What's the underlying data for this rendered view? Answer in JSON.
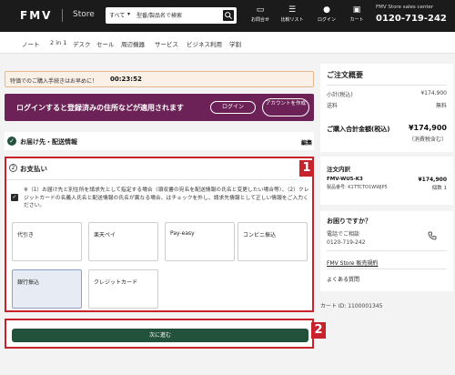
{
  "header": {
    "logo": "FMV",
    "store": "Store",
    "search_category": "すべて",
    "search_placeholder": "型番/製品名で検索",
    "buttons": [
      {
        "label": "お問合せ",
        "icon": "chat-icon"
      },
      {
        "label": "比較リスト",
        "icon": "compare-icon"
      },
      {
        "label": "ログイン",
        "icon": "user-icon"
      },
      {
        "label": "カート",
        "icon": "cart-icon"
      }
    ],
    "sales_center_label": "FMV Store sales center",
    "sales_center_phone": "0120-719-242"
  },
  "nav": [
    "ノート",
    "2 in 1",
    "デスク",
    "セール",
    "周辺機器",
    "サービス",
    "ビジネス利用",
    "学割"
  ],
  "timer": {
    "text": "特価でのご購入手続きはお早めに！",
    "time": "00:23:52"
  },
  "login_banner": {
    "message": "ログインすると登録済みの住所などが適用されます",
    "login_button": "ログイン",
    "create_button": "アカウントを作成"
  },
  "delivery": {
    "title": "お届け先・配送情報",
    "edit": "編集"
  },
  "payment": {
    "step": "2",
    "title": "お支払い",
    "note": "※（1）お届け先と別住所を請求先として指定する場合（領収書の宛名を配送情報の氏名と変更したい場合等）、（2）クレジットカードの名義人氏名と配送情報の氏名が異なる場合、はチェックを外し、請求先情報として正しい情報をご入力ください。",
    "options": [
      "代引き",
      "楽天ペイ",
      "Pay-easy",
      "コンビニ振込",
      "銀行振込",
      "クレジットカード"
    ],
    "selected_option": "銀行振込"
  },
  "next_button": "次に進む",
  "badges": [
    "1",
    "2"
  ],
  "summary": {
    "title": "ご注文概要",
    "subtotal_label": "小計(税込)",
    "subtotal": "¥174,900",
    "shipping_label": "送料",
    "shipping": "無料",
    "total_label": "ご購入合計金額(税込)",
    "total": "¥174,900",
    "tax_note": "（消費税含む）"
  },
  "items": {
    "title": "注文内訳",
    "product": "FMV-WU5-K3",
    "sku": "製品番号: K1TTCTO1WWJP5",
    "price": "¥174,900",
    "qty": "個数 1"
  },
  "help": {
    "title": "お困りですか？",
    "phone_label": "電話でご相談",
    "phone": "0120-719-242",
    "terms": "FMV Store 販売規約",
    "faq": "よくある質問"
  },
  "cart_id": "カート ID: 1100001345",
  "colors": {
    "accent_red": "#c8232c",
    "brand_purple": "#6c2257",
    "button_green": "#22513c"
  }
}
